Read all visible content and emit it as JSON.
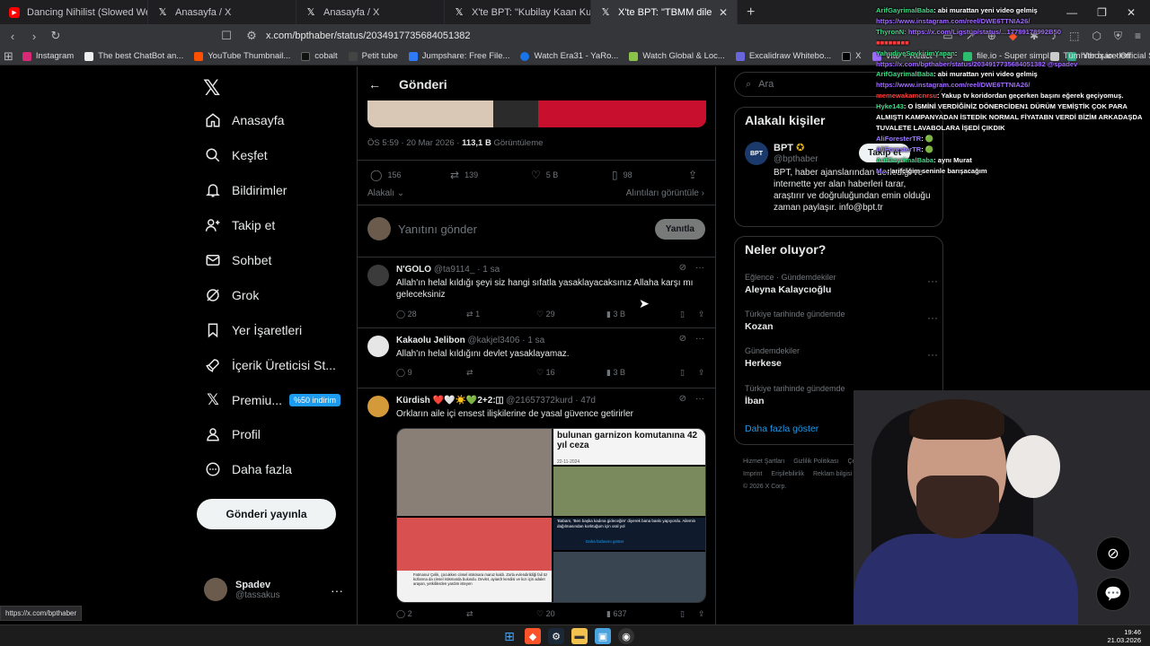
{
  "browser": {
    "tabs": [
      {
        "label": "Dancing Nihilist (Slowed Welly W",
        "icon": "youtube-icon",
        "active": false
      },
      {
        "label": "Anasayfa / X",
        "icon": "x-icon",
        "active": false
      },
      {
        "label": "Anasayfa / X",
        "icon": "x-icon",
        "active": false
      },
      {
        "label": "X'te BPT: \"Kubilay Kaan Kundakçı'nın",
        "icon": "x-icon",
        "active": false
      },
      {
        "label": "X'te BPT: \"TBMM dilekçe komisy",
        "icon": "x-icon",
        "active": true
      }
    ],
    "url": "x.com/bpthaber/status/2034917735684051382",
    "bookmarks": [
      "Instagram",
      "The best ChatBot an...",
      "YouTube Thumbnail...",
      "cobalt",
      "Petit tube",
      "Jumpshare: Free File...",
      "Watch Era31 - YaRo...",
      "Watch Global & Loc...",
      "Excalidraw Whitebo...",
      "X",
      "Vite + React + TS",
      "file.io - Super simpl...",
      "hitbox.io - Official Si..."
    ],
    "all_bookmarks": "Tüm Yer İşaretleri",
    "status_url": "https://x.com/bpthaber"
  },
  "nav": {
    "items": [
      {
        "label": "Anasayfa",
        "icon": "home-icon"
      },
      {
        "label": "Keşfet",
        "icon": "search-icon"
      },
      {
        "label": "Bildirimler",
        "icon": "bell-icon"
      },
      {
        "label": "Takip et",
        "icon": "add-user-icon"
      },
      {
        "label": "Sohbet",
        "icon": "mail-icon"
      },
      {
        "label": "Grok",
        "icon": "grok-icon"
      },
      {
        "label": "Yer İşaretleri",
        "icon": "bookmark-icon"
      },
      {
        "label": "İçerik Üreticisi St...",
        "icon": "rocket-icon"
      },
      {
        "label": "Premiu...",
        "icon": "x-premium-icon",
        "badge": "%50 indirim"
      },
      {
        "label": "Profil",
        "icon": "user-icon"
      },
      {
        "label": "Daha fazla",
        "icon": "more-circle-icon"
      }
    ],
    "post_button": "Gönderi yayınla",
    "user": {
      "name": "Spadev",
      "handle": "@tassakus"
    }
  },
  "post": {
    "header_title": "Gönderi",
    "time": "ÖS 5:59 · 20 Mar 2026 · ",
    "views": "113,1 B",
    "views_label": " Görüntüleme",
    "replies": "156",
    "reposts": "139",
    "likes": "5 B",
    "bookmarks": "98",
    "sort_label": "Alakalı",
    "quotes_label": "Alıntıları görüntüle",
    "reply_placeholder": "Yanıtını gönder",
    "reply_button": "Yanıtla"
  },
  "replies": [
    {
      "name": "N'GOLO",
      "handle": "@ta9114_",
      "time": "· 1 sa",
      "text": "Allah'ın helal kıldığı şeyi siz hangi sıfatla yasaklayacaksınız Allaha karşı mı geleceksiniz",
      "replies": "28",
      "reposts": "1",
      "likes": "29",
      "views": "3 B"
    },
    {
      "name": "Kakaolu Jelibon",
      "handle": "@kakjel3406",
      "time": "· 1 sa",
      "text": "Allah'ın helal kıldığını devlet yasaklayamaz.",
      "replies": "9",
      "reposts": "",
      "likes": "16",
      "views": "3 B"
    },
    {
      "name": "Kürdish ❤️🤍☀️💚2+2:🇮",
      "handle": "@21657372kurd",
      "time": "· 47d",
      "text": "Orkların aile içi ensest ilişkilerine de yasal güvence getirirler",
      "replies": "2",
      "reposts": "",
      "likes": "20",
      "views": "637"
    }
  ],
  "reply_image": {
    "caption_top": "bulunan garnizon komutanına 42 yıl ceza",
    "date": "22-11-2024",
    "caption_left": "Fatmanur Çelik, çocukken cinsel istismara maruz kaldı. Zorla evlendirildiği fail öz kızlarına da cinsel istismarda bulundu. Devlet, ayiardr kendisi ve kızı için adalet arayan, yetkililerden yardım isteyen",
    "caption_right": "'Babam, 'Ben başka kadına gideceğim' diyerek bana baskı yapıyordu. Ailemin dağılmasından korktuğum için oral yol",
    "more": "Daha fazlasını göster"
  },
  "right": {
    "search_placeholder": "Ara",
    "related_title": "Alakalı kişiler",
    "related": {
      "name": "BPT",
      "handle": "@bpthaber",
      "avatar_text": "BPT",
      "bio": "BPT, haber ajanslarından derlediği ve internette yer alan haberleri tarar, araştırır ve doğruluğundan emin olduğu zaman paylaşır. info@bpt.tr",
      "follow": "Takip et"
    },
    "trends_title": "Neler oluyor?",
    "trends": [
      {
        "category": "Eğlence · Gündemdekiler",
        "name": "Aleyna Kalaycıoğlu"
      },
      {
        "category": "Türkiye tarihinde gündemde",
        "name": "Kozan"
      },
      {
        "category": "Gündemdekiler",
        "name": "Herkese"
      },
      {
        "category": "Türkiye tarihinde gündemde",
        "name": "İban"
      }
    ],
    "show_more": "Daha fazla göster",
    "footer": [
      "Hizmet Şartları",
      "Gizlilik Politikası",
      "Çerez",
      "Imprint",
      "Erişilebilirlik",
      "Reklam bilgisi",
      "© 2026 X Corp."
    ]
  },
  "chat": [
    {
      "user": "ArifGayrimalBaba",
      "msg": ": abi murattan yeni video gelmiş"
    },
    {
      "user": "",
      "msg": "https://www.instagram.com/reel/DWE6TTNIA26/",
      "link": true
    },
    {
      "user": "ThyronN",
      "msg": ": https://x.com/Ligstüp/status/...17789178992B50"
    },
    {
      "user": "",
      "msg": ""
    },
    {
      "user": "YahudiyeSoykirimYapan",
      "msg": ":"
    },
    {
      "user": "",
      "msg": "https://x.com/bpthaber/status/2034917735684051382 @spadev",
      "link": true
    },
    {
      "user": "ArifGayrimalBaba",
      "msg": ": abi murattan yeni video gelmiş"
    },
    {
      "user": "",
      "msg": "https://www.instagram.com/reel/DWE6TTNIA26/",
      "link": true
    },
    {
      "user": "memewakamcnrsu",
      "msg": ": Yakup tv koridordan geçerken başını eğerek geçiyomuş."
    },
    {
      "user": "Hyke143",
      "msg": ": O İSMİNİ VERDİĞİNİZ DÖNERCİDEN1 DÜRÜM YEMİŞTİK ÇOK PARA ALMIŞTI KAMPANYADAN İSTEDİK NORMAL FİYATABN VERDİ BİZİM ARKADAŞDA TUVALETE LAVABOLARA İŞEDİ ÇIKDIK",
      "wrap": true
    },
    {
      "user": "AliForesterTR",
      "msg": ": 🟢"
    },
    {
      "user": "AliForesterTR",
      "msg": ": 🟢"
    },
    {
      "user": "ArifGayrimalBaba",
      "msg": ": aynı Murat"
    },
    {
      "user": "M...",
      "msg": ": arifciğim seninle barışacağım"
    }
  ],
  "taskbar": {
    "time": "19:46",
    "date": "21.03.2026"
  }
}
